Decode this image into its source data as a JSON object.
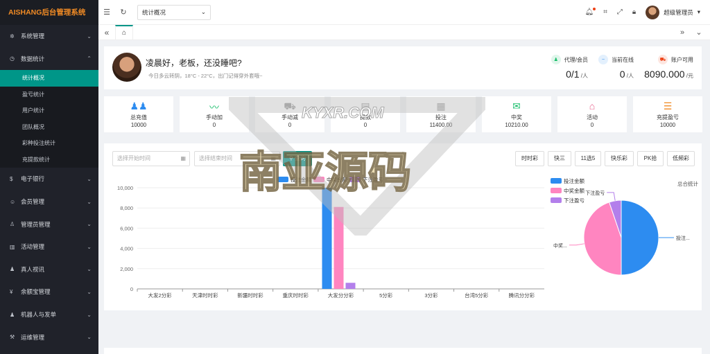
{
  "app": {
    "logo": "AISHANG后台管理系统"
  },
  "sidebar": {
    "items": [
      {
        "icon": "✲",
        "label": "系统管理"
      },
      {
        "icon": "◷",
        "label": "数据统计",
        "expanded": true
      },
      {
        "icon": "$",
        "label": "电子银行"
      },
      {
        "icon": "☺",
        "label": "会员管理"
      },
      {
        "icon": "♙",
        "label": "管理员管理"
      },
      {
        "icon": "▥",
        "label": "活动管理"
      },
      {
        "icon": "♟",
        "label": "真人视讯"
      },
      {
        "icon": "¥",
        "label": "余额宝管理"
      },
      {
        "icon": "♟",
        "label": "机器人与发单"
      },
      {
        "icon": "⚒",
        "label": "运维管理"
      }
    ],
    "submenu": [
      "统计概况",
      "盈亏统计",
      "用户统计",
      "团队概况",
      "彩种投注统计",
      "充提款统计"
    ]
  },
  "topbar": {
    "select_value": "统计概况",
    "user_name": "超级管理员"
  },
  "welcome": {
    "greeting": "凌晨好，老板，还没睡吧?",
    "subtitle": "今日多云转阴，18°C - 22°C，出门记得穿外套哦~",
    "stats": [
      {
        "label": "代理/会员",
        "value": "0/1",
        "unit": "人",
        "color": "#19be6b",
        "icon": "♟"
      },
      {
        "label": "当前在线",
        "value": "0",
        "unit": "人",
        "color": "#2d8cf0",
        "icon": "~"
      },
      {
        "label": "账户可用",
        "value": "8090.000",
        "unit": "元",
        "color": "#ed4014",
        "icon": "⛟"
      }
    ]
  },
  "boxes": [
    {
      "label": "总充值",
      "value": "10000",
      "icon": "♟♟",
      "color": "#2d8cf0"
    },
    {
      "label": "手动加",
      "value": "0",
      "icon": "〰",
      "color": "#19be6b"
    },
    {
      "label": "手动减",
      "value": "0",
      "icon": "⛟",
      "color": "#999"
    },
    {
      "label": "提款",
      "value": "0",
      "icon": "▤",
      "color": "#999"
    },
    {
      "label": "投注",
      "value": "11400.00",
      "icon": "▦",
      "color": "#999"
    },
    {
      "label": "中奖",
      "value": "10210.00",
      "icon": "✉",
      "color": "#19be6b"
    },
    {
      "label": "活动",
      "value": "0",
      "icon": "⌂",
      "color": "#e8618c"
    },
    {
      "label": "充提盈亏",
      "value": "10000",
      "icon": "☰",
      "color": "#f08a24"
    }
  ],
  "filters": {
    "start_placeholder": "选择开始时间",
    "end_placeholder": "选择结束时间",
    "query_label": "查询",
    "lottery_buttons": [
      "时时彩",
      "快三",
      "11选5",
      "快乐彩",
      "PK拾",
      "低频彩"
    ]
  },
  "watermark": {
    "top_text": "KYXR.COM",
    "main_text": "南亚源码"
  },
  "chart_data": [
    {
      "type": "bar",
      "categories": [
        "大发2分彩",
        "天津时时彩",
        "新疆时时彩",
        "重庆时时彩",
        "大发分分彩",
        "5分彩",
        "3分彩",
        "台湾5分彩",
        "腾讯分分彩"
      ],
      "series": [
        {
          "name": "投注金额",
          "values": [
            0,
            0,
            0,
            0,
            11400,
            0,
            0,
            0,
            0
          ],
          "color": "#2d8cf0"
        },
        {
          "name": "中奖金额",
          "values": [
            0,
            0,
            0,
            0,
            8100,
            0,
            0,
            0,
            0
          ],
          "color": "#ff85c0"
        },
        {
          "name": "下注盈亏",
          "values": [
            0,
            0,
            0,
            0,
            600,
            0,
            0,
            0,
            0
          ],
          "color": "#b37feb"
        }
      ],
      "ylim": [
        0,
        10000
      ],
      "yticks": [
        "0",
        "2,000",
        "4,000",
        "6,000",
        "8,000",
        "10,000"
      ],
      "legend": "top-center"
    },
    {
      "type": "pie",
      "title": "总合统计",
      "labels": [
        "投注金额",
        "中奖金额",
        "下注盈亏"
      ],
      "slice_labels": [
        "投注...",
        "中奖...",
        "下注盈亏"
      ],
      "values": [
        11400,
        10210,
        1190
      ],
      "colors": [
        "#2d8cf0",
        "#ff85c0",
        "#b37feb"
      ],
      "legend": "top-left"
    }
  ]
}
